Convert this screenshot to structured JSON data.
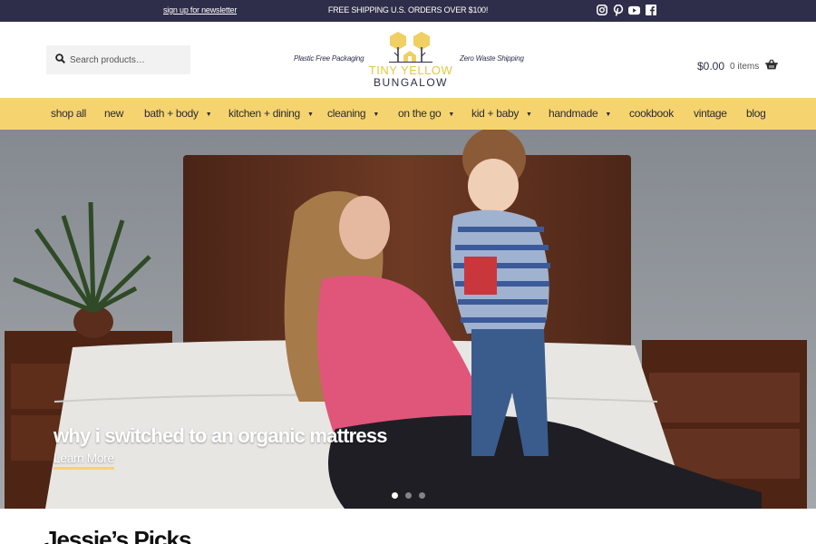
{
  "topbar": {
    "newsletter_link": "sign up for newsletter",
    "shipping_text": "FREE SHIPPING U.S. ORDERS OVER $100!",
    "social_icons": [
      "instagram-icon",
      "pinterest-icon",
      "youtube-icon",
      "facebook-icon"
    ],
    "background": "#2e2e4a"
  },
  "header": {
    "search": {
      "placeholder": "Search products…"
    },
    "tagline_left": "Plastic Free Packaging",
    "tagline_right": "Zero Waste Shipping",
    "logo": {
      "line1": "TINY YELLOW",
      "line2": "BUNGALOW"
    },
    "cart": {
      "amount": "$0.00",
      "items": "0 items",
      "icon": "basket-icon"
    }
  },
  "nav": {
    "background": "#f5d46f",
    "items": [
      {
        "label": "shop all",
        "dropdown": false
      },
      {
        "label": "new",
        "dropdown": false
      },
      {
        "label": "bath + body",
        "dropdown": true
      },
      {
        "label": "kitchen + dining",
        "dropdown": true
      },
      {
        "label": "cleaning",
        "dropdown": true
      },
      {
        "label": "on the go",
        "dropdown": true
      },
      {
        "label": "kid + baby",
        "dropdown": true
      },
      {
        "label": "handmade",
        "dropdown": true
      },
      {
        "label": "cookbook",
        "dropdown": false
      },
      {
        "label": "vintage",
        "dropdown": false
      },
      {
        "label": "blog",
        "dropdown": false
      }
    ]
  },
  "hero": {
    "headline": "why i switched to an organic mattress",
    "cta": "Learn More",
    "slides": 3,
    "active_slide": 1
  },
  "section": {
    "title": "Jessie’s Picks"
  }
}
